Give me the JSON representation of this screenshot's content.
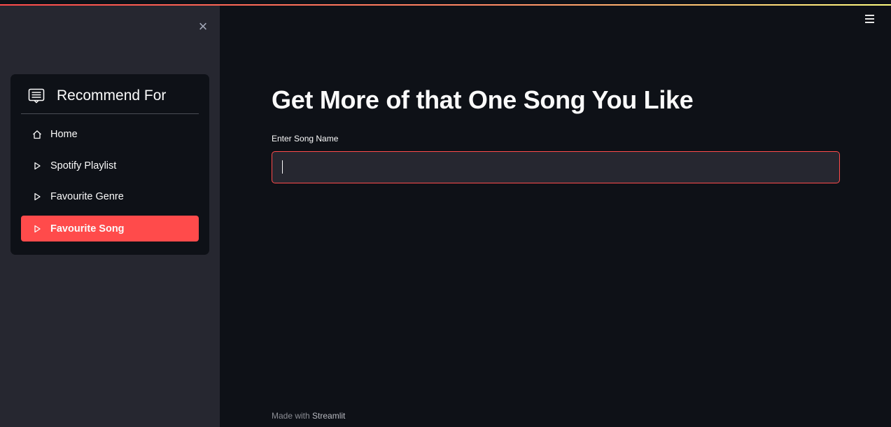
{
  "sidebar": {
    "close_glyph": "×",
    "menu_title": "Recommend For",
    "menu_icon": "menu-card-icon",
    "items": [
      {
        "label": "Home",
        "icon": "house-icon",
        "active": false
      },
      {
        "label": "Spotify Playlist",
        "icon": "play-icon",
        "active": false
      },
      {
        "label": "Favourite Genre",
        "icon": "play-icon",
        "active": false
      },
      {
        "label": "Favourite Song",
        "icon": "play-icon",
        "active": true
      }
    ]
  },
  "main": {
    "title": "Get More of that One Song You Like",
    "song_field": {
      "label": "Enter Song Name",
      "value": "",
      "placeholder": ""
    }
  },
  "footer": {
    "prefix": "Made with",
    "brand": "Streamlit"
  },
  "colors": {
    "accent": "#ff4b4b",
    "background": "#0e1117",
    "sidebar": "#262730",
    "text": "#fafafa"
  }
}
